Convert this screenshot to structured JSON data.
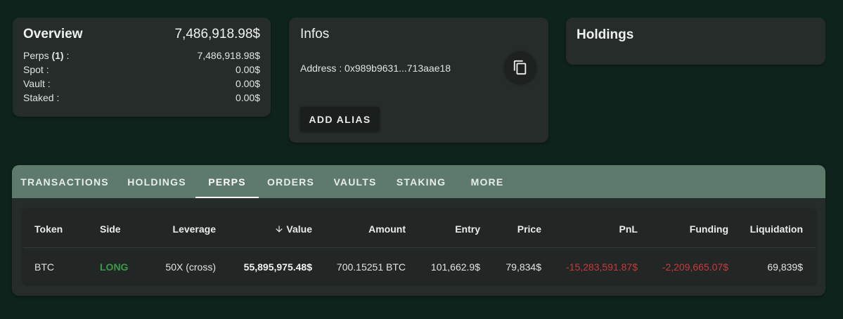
{
  "overview": {
    "title": "Overview",
    "total": "7,486,918.98$",
    "rows": [
      {
        "label_prefix": "Perps ",
        "label_bold": "(1)",
        "label_suffix": " :",
        "value": "7,486,918.98$"
      },
      {
        "label": "Spot :",
        "value": "0.00$"
      },
      {
        "label": "Vault :",
        "value": "0.00$"
      },
      {
        "label": "Staked :",
        "value": "0.00$"
      }
    ]
  },
  "infos": {
    "title": "Infos",
    "address": "Address : 0x989b9631...713aae18",
    "copy_icon": "copy-icon",
    "add_alias_label": "ADD ALIAS"
  },
  "holdings_card": {
    "title": "Holdings"
  },
  "tabs": [
    {
      "label": "TRANSACTIONS",
      "active": false
    },
    {
      "label": "HOLDINGS",
      "active": false
    },
    {
      "label": "PERPS",
      "active": true
    },
    {
      "label": "ORDERS",
      "active": false
    },
    {
      "label": "VAULTS",
      "active": false
    },
    {
      "label": "STAKING",
      "active": false
    },
    {
      "label": "MORE",
      "active": false
    }
  ],
  "table": {
    "sort_icon": "arrow-down-icon",
    "headers": [
      "Token",
      "Side",
      "Leverage",
      "Value",
      "Amount",
      "Entry",
      "Price",
      "PnL",
      "Funding",
      "Liquidation"
    ],
    "rows": [
      {
        "token": "BTC",
        "side": "LONG",
        "leverage": "50X (cross)",
        "value": "55,895,975.48$",
        "amount": "700.15251 BTC",
        "entry": "101,662.9$",
        "price": "79,834$",
        "pnl": "-15,283,591.87$",
        "funding": "-2,209,665.07$",
        "liquidation": "69,839$"
      }
    ]
  },
  "colors": {
    "background": "#0f231d",
    "card": "#262c2a",
    "tab_bar": "#5d7a6c",
    "negative": "#c9393c",
    "positive": "#3a9a48"
  }
}
